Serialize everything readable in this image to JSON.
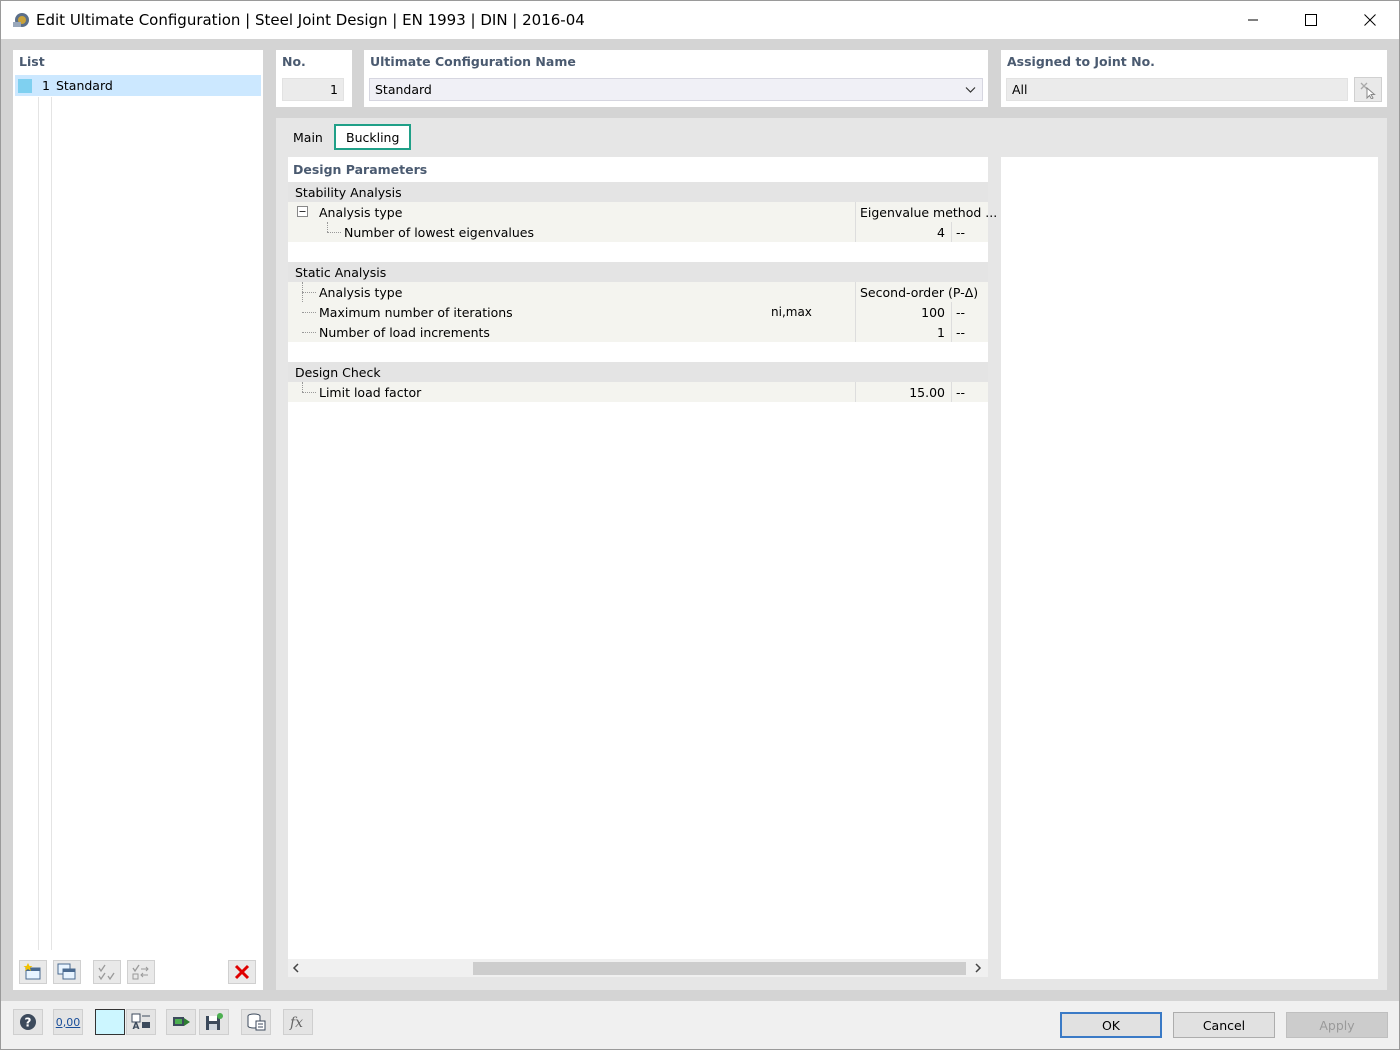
{
  "window": {
    "title": "Edit Ultimate Configuration | Steel Joint Design | EN 1993 | DIN | 2016-04"
  },
  "list": {
    "label": "List",
    "items": [
      {
        "number": "1",
        "name": "Standard",
        "color": "#7fd0f0"
      }
    ]
  },
  "number_field": {
    "label": "No.",
    "value": "1"
  },
  "config_name": {
    "label": "Ultimate Configuration Name",
    "value": "Standard"
  },
  "assigned": {
    "label": "Assigned to Joint No.",
    "value": "All"
  },
  "tabs": [
    {
      "label": "Main",
      "active": false
    },
    {
      "label": "Buckling",
      "active": true
    }
  ],
  "design_parameters": {
    "title": "Design Parameters",
    "sections": [
      {
        "title": "Stability Analysis",
        "rows": [
          {
            "label": "Analysis type",
            "symbol": "",
            "value": "Eigenvalue method ...",
            "unit": ""
          },
          {
            "label": "Number of lowest eigenvalues",
            "symbol": "",
            "value": "4",
            "unit": "--"
          }
        ]
      },
      {
        "title": "Static Analysis",
        "rows": [
          {
            "label": "Analysis type",
            "symbol": "",
            "value": "Second-order (P-Δ)",
            "unit": ""
          },
          {
            "label": "Maximum number of iterations",
            "symbol": "ni,max",
            "value": "100",
            "unit": "--"
          },
          {
            "label": "Number of load increments",
            "symbol": "",
            "value": "1",
            "unit": "--"
          }
        ]
      },
      {
        "title": "Design Check",
        "rows": [
          {
            "label": "Limit load factor",
            "symbol": "",
            "value": "15.00",
            "unit": "--"
          }
        ]
      }
    ]
  },
  "bottom_numeric_label": "0,00",
  "buttons": {
    "ok": "OK",
    "cancel": "Cancel",
    "apply": "Apply"
  },
  "colors": {
    "accent_tab": "#20a088",
    "selection": "#cce8ff",
    "label_text": "#4a5a70"
  }
}
